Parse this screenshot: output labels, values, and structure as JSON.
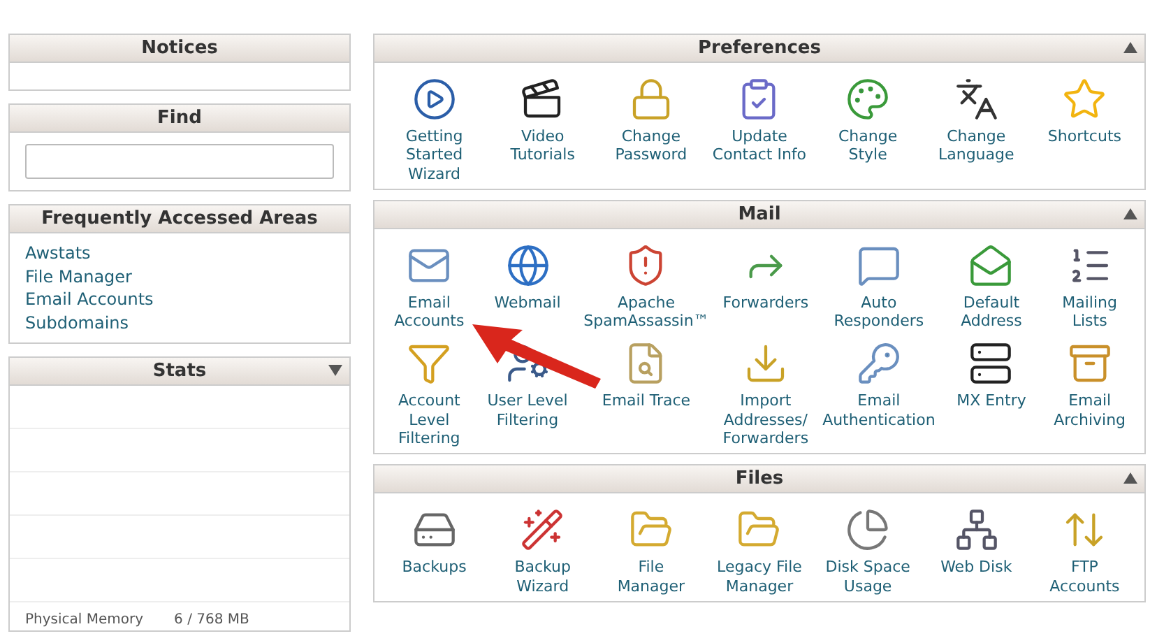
{
  "sidebar": {
    "notices": {
      "title": "Notices"
    },
    "find": {
      "title": "Find"
    },
    "frequent": {
      "title": "Frequently Accessed Areas",
      "links": [
        "Awstats",
        "File Manager",
        "Email Accounts",
        "Subdomains"
      ]
    },
    "stats": {
      "title": "Stats",
      "expanded": true,
      "rows": [
        {
          "label": "Physical Memory",
          "value": "6 / 768 MB"
        }
      ]
    }
  },
  "sections": [
    {
      "title": "Preferences",
      "expanded": true,
      "items": [
        "Getting Started Wizard",
        "Video Tutorials",
        "Change Password",
        "Update Contact Info",
        "Change Style",
        "Change Language",
        "Shortcuts"
      ]
    },
    {
      "title": "Mail",
      "expanded": true,
      "items": [
        "Email Accounts",
        "Webmail",
        "Apache SpamAssassin™",
        "Forwarders",
        "Auto Responders",
        "Default Address",
        "Mailing Lists",
        "Account Level Filtering",
        "User Level Filtering",
        "Email Trace",
        "Import Addresses/ Forwarders",
        "Email Authentication",
        "MX Entry",
        "Email Archiving"
      ]
    },
    {
      "title": "Files",
      "expanded": true,
      "items": [
        "Backups",
        "Backup Wizard",
        "File Manager",
        "Legacy File Manager",
        "Disk Space Usage",
        "Web Disk",
        "FTP Accounts"
      ]
    }
  ]
}
